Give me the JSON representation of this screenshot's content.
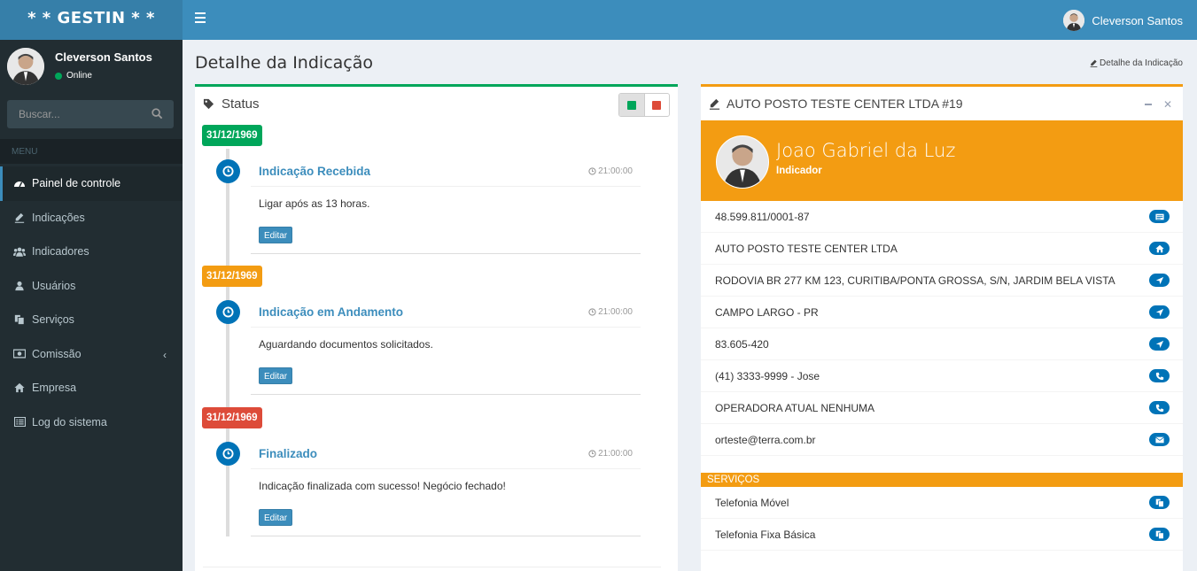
{
  "app": {
    "logo": "* * GESTIN * *"
  },
  "topbar": {
    "user_name": "Cleverson Santos"
  },
  "sidebar": {
    "user_name": "Cleverson Santos",
    "user_status": "Online",
    "search_placeholder": "Buscar...",
    "menu_header": "MENU",
    "items": [
      {
        "label": "Painel de controle",
        "icon": "dashboard-icon"
      },
      {
        "label": "Indicações",
        "icon": "pencil-icon"
      },
      {
        "label": "Indicadores",
        "icon": "users-icon"
      },
      {
        "label": "Usuários",
        "icon": "user-icon"
      },
      {
        "label": "Serviços",
        "icon": "files-icon"
      },
      {
        "label": "Comissão",
        "icon": "money-icon"
      },
      {
        "label": "Empresa",
        "icon": "home-icon"
      },
      {
        "label": "Log do sistema",
        "icon": "list-icon"
      }
    ]
  },
  "page": {
    "title": "Detalhe da Indicação",
    "breadcrumb": "Detalhe da Indicação"
  },
  "status_box": {
    "title": "Status",
    "toggle_colors": [
      "#00a65a",
      "#dd4b39"
    ],
    "timeline": [
      {
        "date": "31/12/1969",
        "date_color": "#00a65a",
        "title": "Indicação Recebida",
        "time": "21:00:00",
        "body": "Ligar após as 13 horas.",
        "edit_label": "Editar"
      },
      {
        "date": "31/12/1969",
        "date_color": "#f39c12",
        "title": "Indicação em Andamento",
        "time": "21:00:00",
        "body": "Aguardando documentos solicitados.",
        "edit_label": "Editar"
      },
      {
        "date": "31/12/1969",
        "date_color": "#dd4b39",
        "title": "Finalizado",
        "time": "21:00:00",
        "body": "Indicação finalizada com sucesso! Negócio fechado!",
        "edit_label": "Editar"
      }
    ]
  },
  "detail_box": {
    "title": "AUTO POSTO TESTE CENTER LTDA #19",
    "profile": {
      "name": "Joao Gabriel da Luz",
      "role": "Indicador"
    },
    "info": [
      {
        "text": "48.599.811/0001-87",
        "icon": "id-card-icon"
      },
      {
        "text": "AUTO POSTO TESTE CENTER LTDA",
        "icon": "home-icon"
      },
      {
        "text": "RODOVIA BR 277 KM 123, CURITIBA/PONTA GROSSA, S/N, JARDIM BELA VISTA",
        "icon": "location-arrow-icon"
      },
      {
        "text": "CAMPO LARGO - PR",
        "icon": "location-arrow-icon"
      },
      {
        "text": "83.605-420",
        "icon": "location-arrow-icon"
      },
      {
        "text": "(41) 3333-9999 - Jose",
        "icon": "phone-icon"
      },
      {
        "text": "OPERADORA ATUAL NENHUMA",
        "icon": "phone-icon"
      },
      {
        "text": "orteste@terra.com.br",
        "icon": "envelope-icon"
      }
    ],
    "services_header": "SERVIÇOS",
    "services": [
      {
        "text": "Telefonia Móvel",
        "icon": "files-icon"
      },
      {
        "text": "Telefonia Fixa Básica",
        "icon": "files-icon"
      }
    ]
  },
  "colors": {
    "primary": "#3c8dbc",
    "success": "#00a65a",
    "warning": "#f39c12",
    "danger": "#dd4b39",
    "sidebar": "#222d32"
  }
}
